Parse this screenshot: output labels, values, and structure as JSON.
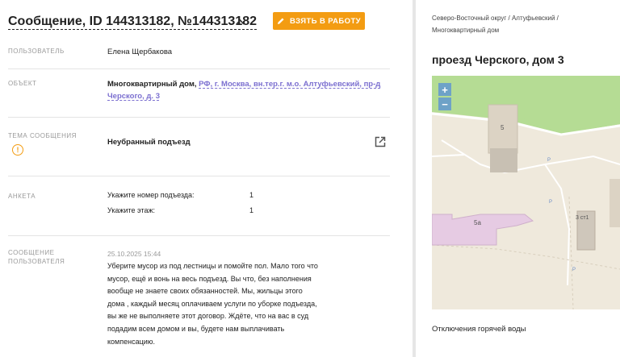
{
  "header": {
    "title": "Сообщение, ID 144313182, №144313182",
    "chevron": "^",
    "take_button_label": "ВЗЯТЬ В РАБОТУ"
  },
  "fields": {
    "user_label": "ПОЛЬЗОВАТЕЛЬ",
    "user_value": "Елена Щербакова",
    "object_label": "ОБЪЕКТ",
    "object_type": "Многоквартирный дом,",
    "object_address_line1": "РФ, г. Москва, вн.тер.г. м.о. Алтуфьевский, пр-д",
    "object_address_line2": "Черского, д. 3",
    "topic_label": "ТЕМА СООБЩЕНИЯ",
    "topic_value": "Неубранный подъезд",
    "survey_label": "АНКЕТА",
    "survey": [
      {
        "question": "Укажите номер подъезда:",
        "answer": "1"
      },
      {
        "question": "Укажите этаж:",
        "answer": "1"
      }
    ],
    "message_label_line1": "СООБЩЕНИЕ",
    "message_label_line2": "ПОЛЬЗОВАТЕЛЯ",
    "message_date": "25.10.2025 15:44",
    "message_text": "Уберите мусор из под лестницы и помойте пол. Мало того что мусор, ещё и вонь на весь подъезд. Вы что, без наполнения вообще не знаете своих обязанностей. Мы, жильцы этого дома , каждый месяц оплачиваем услуги по уборке подъезда, вы же не выполняете этот договор. Ждёте, что на вас в суд подадим всем домом и вы, будете нам выплачивать компенсацию."
  },
  "sidebar": {
    "breadcrumb": "Северо-Восточный округ / Алтуфьевский / Многоквартирный дом",
    "address_title": "проезд Черского, дом 3",
    "map": {
      "zoom_in": "+",
      "zoom_out": "−",
      "labels": [
        "5",
        "5а",
        "3 ст1",
        "Р",
        "Р",
        "Р"
      ]
    },
    "outage_label": "Отключения горячей воды"
  },
  "colors": {
    "accent_orange": "#f39c12",
    "link_purple": "#7b6fd0",
    "muted_gray": "#9a9a9a"
  },
  "icons": [
    "pencil-icon",
    "warning-icon",
    "external-link-icon",
    "chevron-up-icon"
  ]
}
